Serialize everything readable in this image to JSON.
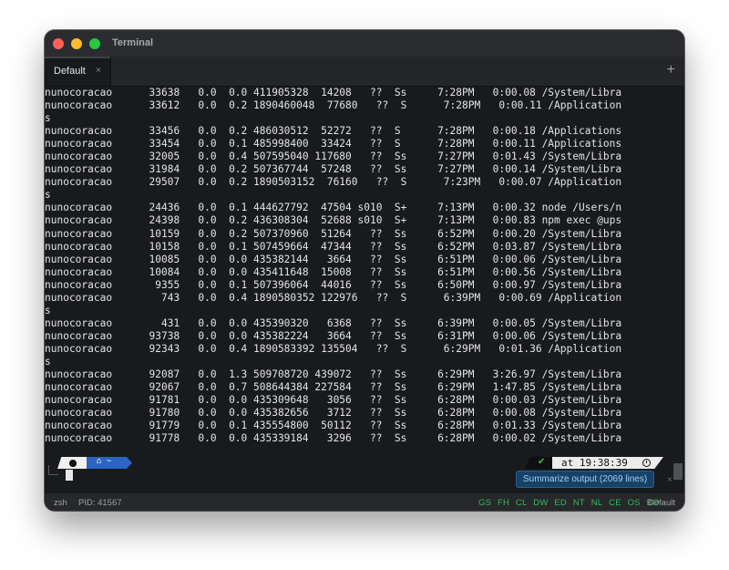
{
  "window": {
    "title": "Terminal",
    "tab_label": "Default",
    "tab_close": "×",
    "new_tab": "+"
  },
  "terminal": {
    "lines": [
      "nunocoracao      33638   0.0  0.0 411905328  14208   ??  Ss     7:28PM   0:00.08 /System/Libra",
      "nunocoracao      33612   0.0  0.2 1890460048  77680   ??  S      7:28PM   0:00.11 /Application",
      "s",
      "nunocoracao      33456   0.0  0.2 486030512  52272   ??  S      7:28PM   0:00.18 /Applications",
      "nunocoracao      33454   0.0  0.1 485998400  33424   ??  S      7:28PM   0:00.11 /Applications",
      "nunocoracao      32005   0.0  0.4 507595040 117680   ??  Ss     7:27PM   0:01.43 /System/Libra",
      "nunocoracao      31984   0.0  0.2 507367744  57248   ??  Ss     7:27PM   0:00.14 /System/Libra",
      "nunocoracao      29507   0.0  0.2 1890503152  76160   ??  S      7:23PM   0:00.07 /Application",
      "s",
      "nunocoracao      24436   0.0  0.1 444627792  47504 s010  S+     7:13PM   0:00.32 node /Users/n",
      "nunocoracao      24398   0.0  0.2 436308304  52688 s010  S+     7:13PM   0:00.83 npm exec @ups",
      "nunocoracao      10159   0.0  0.2 507370960  51264   ??  Ss     6:52PM   0:00.20 /System/Libra",
      "nunocoracao      10158   0.0  0.1 507459664  47344   ??  Ss     6:52PM   0:03.87 /System/Libra",
      "nunocoracao      10085   0.0  0.0 435382144   3664   ??  Ss     6:51PM   0:00.06 /System/Libra",
      "nunocoracao      10084   0.0  0.0 435411648  15008   ??  Ss     6:51PM   0:00.56 /System/Libra",
      "nunocoracao       9355   0.0  0.1 507396064  44016   ??  Ss     6:50PM   0:00.97 /System/Libra",
      "nunocoracao        743   0.0  0.4 1890580352 122976   ??  S      6:39PM   0:00.69 /Application",
      "s",
      "nunocoracao        431   0.0  0.0 435390320   6368   ??  Ss     6:39PM   0:00.05 /System/Libra",
      "nunocoracao      93738   0.0  0.0 435382224   3664   ??  Ss     6:31PM   0:00.06 /System/Libra",
      "nunocoracao      92343   0.0  0.4 1890583392 135504   ??  S      6:29PM   0:01.36 /Application",
      "s",
      "nunocoracao      92087   0.0  1.3 509708720 439072   ??  Ss     6:29PM   3:26.97 /System/Libra",
      "nunocoracao      92067   0.0  0.7 508644384 227584   ??  Ss     6:29PM   1:47.85 /System/Libra",
      "nunocoracao      91781   0.0  0.0 435309648   3056   ??  Ss     6:28PM   0:00.03 /System/Libra",
      "nunocoracao      91780   0.0  0.0 435382656   3712   ??  Ss     6:28PM   0:00.08 /System/Libra",
      "nunocoracao      91779   0.0  0.1 435554800  50112   ??  Ss     6:28PM   0:01.33 /System/Libra",
      "nunocoracao      91778   0.0  0.0 435339184   3296   ??  Ss     6:28PM   0:00.02 /System/Libra"
    ]
  },
  "prompt": {
    "dir_label": "~",
    "status_check": "✔",
    "time_label": "at 19:38:39"
  },
  "actions": {
    "summarize_label": "Summarize output (2069 lines)",
    "dismiss": "×"
  },
  "statusbar": {
    "shell": "zsh",
    "pid": "PID: 41567",
    "flags": [
      "GS",
      "FH",
      "CL",
      "DW",
      "ED",
      "NT",
      "NL",
      "CE",
      "OS",
      "BO"
    ],
    "profile": "Default"
  },
  "colors": {
    "window_bg": "#181a1d",
    "accent_blue": "#2b64c4",
    "flag_green": "#36b95c",
    "summarize_bg": "#174265"
  },
  "icons": [
    "apple-icon",
    "home-icon",
    "clock-icon",
    "checkmark-icon",
    "close-icon",
    "plus-icon"
  ]
}
